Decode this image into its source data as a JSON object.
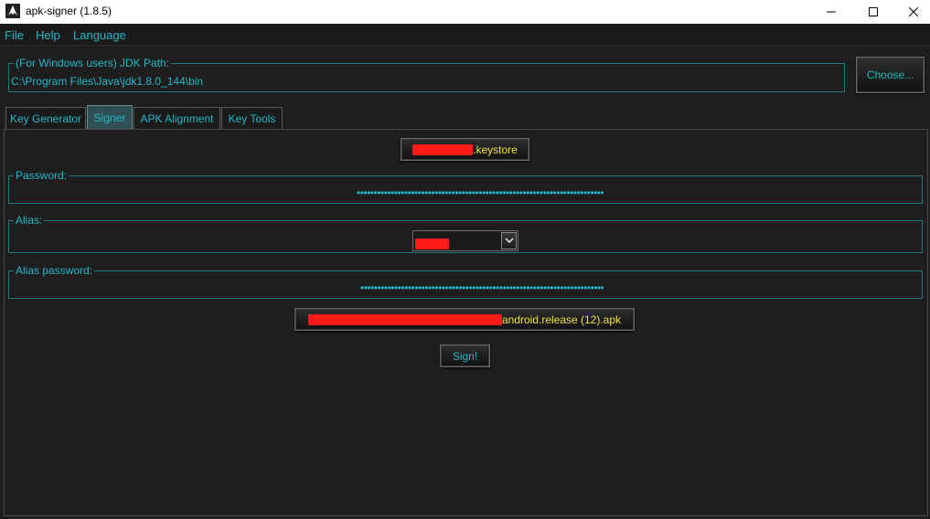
{
  "window": {
    "title": "apk-signer (1.8.5)",
    "icons": [
      "app-icon",
      "minimize-icon",
      "maximize-icon",
      "close-icon"
    ]
  },
  "menubar": {
    "items": [
      "File",
      "Help",
      "Language"
    ]
  },
  "jdk": {
    "legend": "(For Windows users) JDK Path:",
    "value": "C:\\Program Files\\Java\\jdk1.8.0_144\\bin",
    "choose_label": "Choose..."
  },
  "tabs": [
    {
      "label": "Key Generator",
      "active": false
    },
    {
      "label": "Signer",
      "active": true
    },
    {
      "label": "APK Alignment",
      "active": false
    },
    {
      "label": "Key Tools",
      "active": false
    }
  ],
  "signer": {
    "keystore_suffix": ".keystore",
    "password_legend": "Password:",
    "password_mask": "•••••••••••••••••••••••••••••••••••••••••••••••••••••••••••••••••••••••••",
    "alias_legend": "Alias:",
    "alias_password_legend": "Alias password:",
    "alias_password_mask": "••••••••••••••••••••••••••••••••••••••••••••••••••••••••••••••••••••••••",
    "apk_suffix": "android.release (12).apk",
    "sign_label": "Sign!"
  },
  "colors": {
    "accent": "#25b8c8",
    "highlight_text": "#f0e040",
    "redaction": "#ff1a1a",
    "background": "#1e1e1e"
  }
}
